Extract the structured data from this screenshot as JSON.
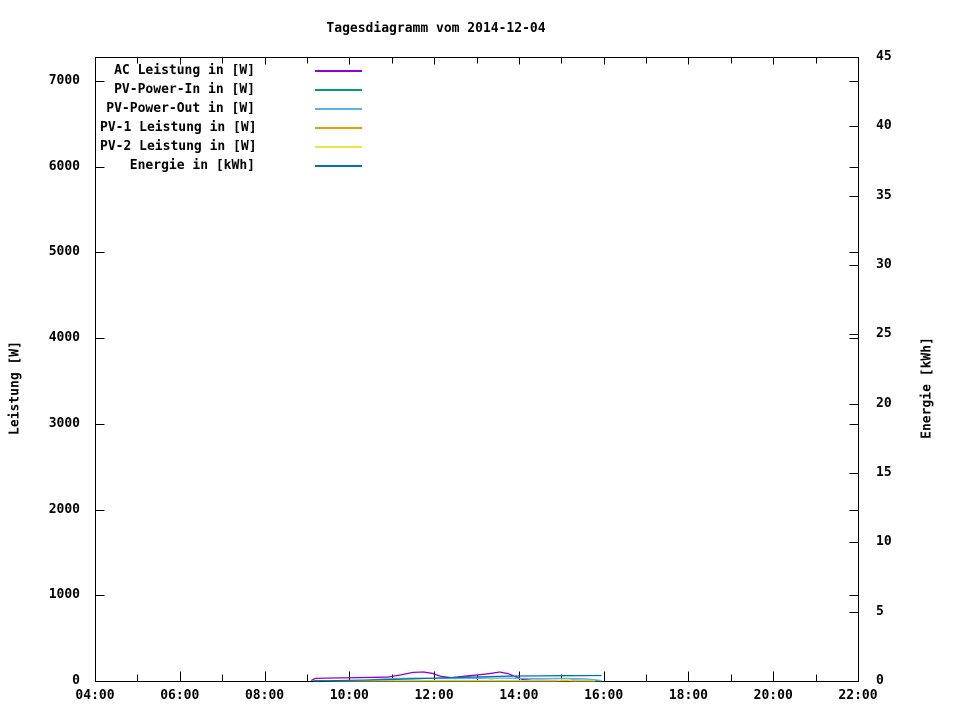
{
  "colors": {
    "background": "#ffffff",
    "text": "#000000",
    "frame": "#000000"
  },
  "chart_data": {
    "type": "line",
    "title": "Tagesdiagramm vom 2014-12-04",
    "xlabel": "",
    "ylabel_left": "Leistung [W]",
    "ylabel_right": "Energie [kWh]",
    "x_ticks": [
      "04:00",
      "06:00",
      "08:00",
      "10:00",
      "12:00",
      "14:00",
      "16:00",
      "18:00",
      "20:00",
      "22:00"
    ],
    "x_minor_tick_hours": 1,
    "x_range_hours": [
      4,
      22
    ],
    "ylim_left": [
      0,
      7280
    ],
    "y_ticks_left": [
      0,
      1000,
      2000,
      3000,
      4000,
      5000,
      6000,
      7000
    ],
    "ylim_right": [
      0,
      45
    ],
    "y_ticks_right": [
      0,
      5,
      10,
      15,
      20,
      25,
      30,
      35,
      40,
      45
    ],
    "grid": false,
    "legend_position": "top-left-inside",
    "series": [
      {
        "label": "AC Leistung in [W]",
        "color": "#9400d3",
        "axis": "left",
        "points": [
          [
            9.1,
            5
          ],
          [
            9.2,
            30
          ],
          [
            9.6,
            35
          ],
          [
            10.2,
            40
          ],
          [
            10.9,
            45
          ],
          [
            11.2,
            70
          ],
          [
            11.5,
            100
          ],
          [
            11.75,
            105
          ],
          [
            11.95,
            90
          ],
          [
            12.15,
            55
          ],
          [
            12.4,
            40
          ],
          [
            12.7,
            55
          ],
          [
            13.0,
            70
          ],
          [
            13.3,
            85
          ],
          [
            13.55,
            105
          ],
          [
            13.75,
            85
          ],
          [
            13.95,
            45
          ],
          [
            14.1,
            15
          ],
          [
            14.3,
            8
          ],
          [
            14.8,
            6
          ],
          [
            15.3,
            8
          ],
          [
            15.6,
            6
          ],
          [
            15.9,
            4
          ]
        ]
      },
      {
        "label": "PV-Power-In in [W]",
        "color": "#009e73",
        "axis": "left",
        "points": [
          [
            9.15,
            2
          ],
          [
            12.0,
            3
          ],
          [
            15.95,
            2
          ]
        ]
      },
      {
        "label": "PV-Power-Out in [W]",
        "color": "#56b4e9",
        "axis": "left",
        "points": [
          [
            10.25,
            3
          ],
          [
            10.6,
            18
          ],
          [
            11.0,
            28
          ],
          [
            11.5,
            33
          ],
          [
            12.0,
            30
          ],
          [
            12.5,
            28
          ],
          [
            13.0,
            32
          ],
          [
            13.5,
            35
          ],
          [
            14.0,
            30
          ],
          [
            14.5,
            28
          ],
          [
            15.0,
            30
          ],
          [
            15.5,
            28
          ],
          [
            15.85,
            12
          ],
          [
            15.95,
            4
          ]
        ]
      },
      {
        "label": "PV-1 Leistung in [W]",
        "color": "#e69f00",
        "axis": "left",
        "points": [
          [
            9.4,
            1
          ],
          [
            13.2,
            1
          ],
          [
            13.35,
            9
          ],
          [
            13.5,
            1
          ],
          [
            15.8,
            1
          ]
        ]
      },
      {
        "label": "PV-2 Leistung in [W]",
        "color": "#f0e442",
        "axis": "left",
        "points": [
          [
            9.4,
            1
          ],
          [
            14.9,
            1
          ],
          [
            15.0,
            13
          ],
          [
            15.15,
            14
          ],
          [
            15.25,
            1
          ],
          [
            15.8,
            1
          ]
        ]
      },
      {
        "label": "Energie in [kWh]",
        "color": "#0072b2",
        "axis": "right",
        "points": [
          [
            9.15,
            0
          ],
          [
            10.0,
            0.04
          ],
          [
            10.5,
            0.07
          ],
          [
            11.0,
            0.11
          ],
          [
            11.5,
            0.16
          ],
          [
            12.0,
            0.21
          ],
          [
            12.5,
            0.25
          ],
          [
            13.0,
            0.29
          ],
          [
            13.5,
            0.33
          ],
          [
            14.0,
            0.36
          ],
          [
            14.5,
            0.37
          ],
          [
            15.0,
            0.38
          ],
          [
            15.5,
            0.39
          ],
          [
            15.95,
            0.4
          ]
        ]
      }
    ]
  }
}
